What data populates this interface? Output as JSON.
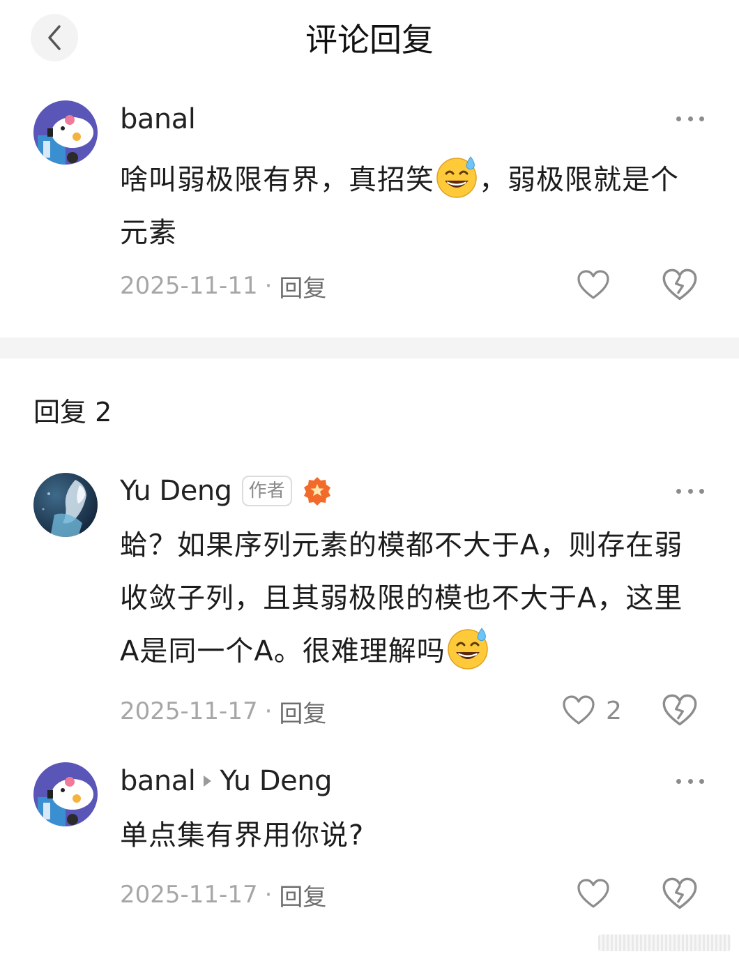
{
  "header": {
    "title": "评论回复"
  },
  "main_comment": {
    "author": "banal",
    "text_before_emoji": "啥叫弱极限有界，真招笑",
    "emoji": "sweat-smile-emoji",
    "text_after_emoji": "，弱极限就是个元素",
    "date": "2025-11-11",
    "dot": "·",
    "reply_label": "回复"
  },
  "replies_section": {
    "title": "回复 2"
  },
  "replies": [
    {
      "author": "Yu Deng",
      "badge": "作者",
      "text_before_emoji": "蛤？如果序列元素的模都不大于A，则存在弱收敛子列，且其弱极限的模也不大于A，这里A是同一个A。很难理解吗",
      "emoji": "sweat-smile-emoji",
      "date": "2025-11-17",
      "dot": "·",
      "reply_label": "回复",
      "like_count": "2"
    },
    {
      "author": "banal",
      "reply_to": "Yu Deng",
      "text": "单点集有界用你说?",
      "date": "2025-11-17",
      "dot": "·",
      "reply_label": "回复"
    }
  ],
  "colors": {
    "accent_orange": "#f26b2a",
    "emoji_yellow": "#ffca3a",
    "muted_text": "#a6a6a6",
    "icon_gray": "#8c8c8c"
  }
}
